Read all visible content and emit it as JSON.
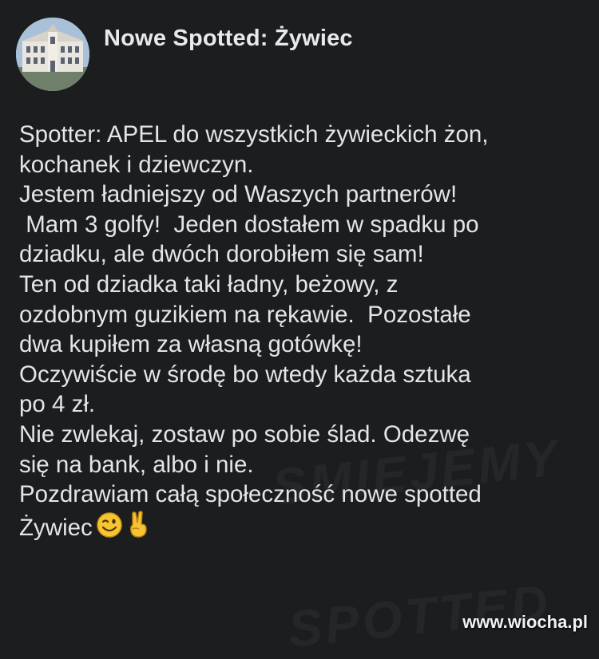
{
  "post": {
    "page_name": "Nowe Spotted: Żywiec",
    "lines": [
      "Spotter: APEL do wszystkich żywieckich żon,",
      "kochanek i dziewczyn.",
      "Jestem ładniejszy od Waszych partnerów!",
      " Mam 3 golfy!  Jeden dostałem w spadku po",
      "dziadku, ale dwóch dorobiłem się sam!",
      "Ten od dziadka taki ładny, beżowy, z",
      "ozdobnym guzikiem na rękawie.  Pozostałe",
      "dwa kupiłem za własną gotówkę!",
      "Oczywiście w środę bo wtedy każda sztuka",
      "po 4 zł.",
      "Nie zwlekaj, zostaw po sobie ślad. Odezwę",
      "się na bank, albo i nie.",
      "Pozdrawiam całą społeczność nowe spotted",
      "Żywiec"
    ],
    "emojis": [
      "winking-face-icon",
      "victory-hand-icon"
    ]
  },
  "watermark": {
    "top": "SMIEJEMY",
    "bottom": "SPOTTED"
  },
  "site_tag": "www.wiocha.pl"
}
